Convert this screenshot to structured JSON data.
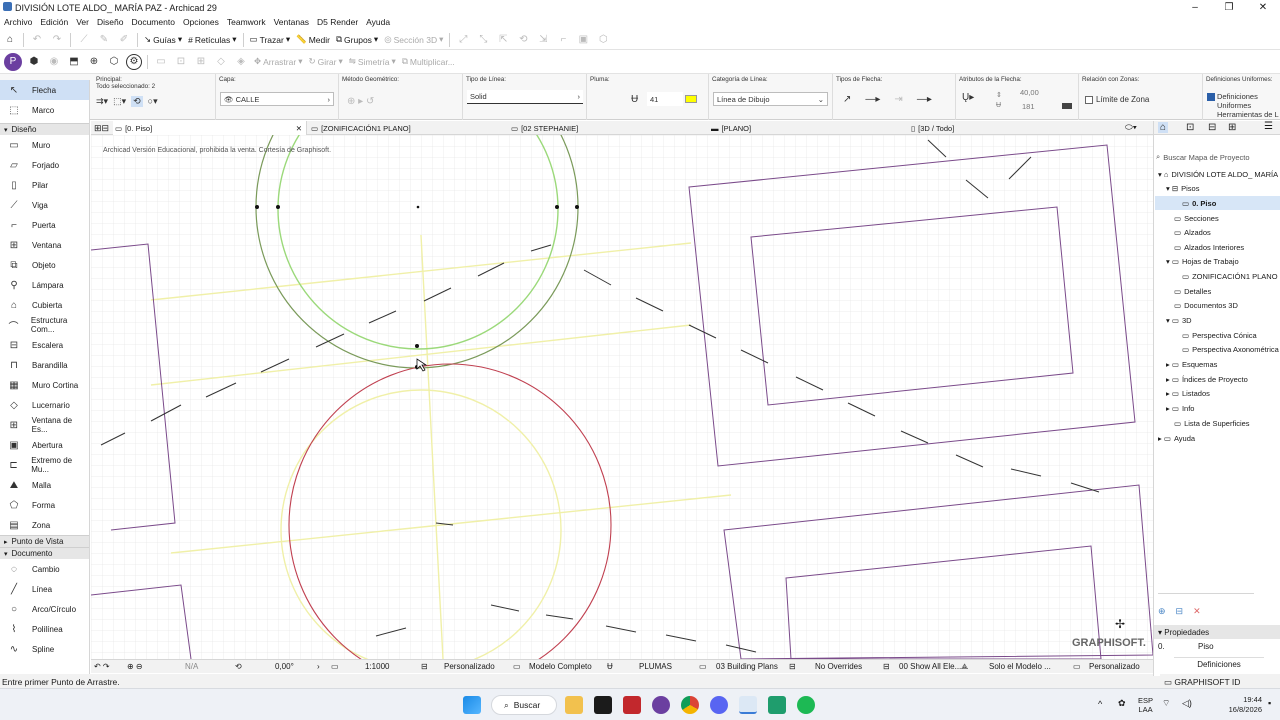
{
  "window": {
    "title": "DIVISIÓN LOTE ALDO_ MARÍA PAZ - Archicad 29",
    "min": "–",
    "max": "❐",
    "close": "✕"
  },
  "menu": [
    "Archivo",
    "Edición",
    "Ver",
    "Diseño",
    "Documento",
    "Opciones",
    "Teamwork",
    "Ventanas",
    "D5 Render",
    "Ayuda"
  ],
  "toolbar1": {
    "guias": "Guías",
    "reticulas": "Retículas",
    "trazar": "Trazar",
    "medir": "Medir",
    "grupos": "Grupos",
    "seccion3d": "Sección 3D"
  },
  "toolbar2": {
    "arrastrar": "Arrastrar",
    "girar": "Girar",
    "simetria": "Simetría",
    "multiplicar": "Multiplicar..."
  },
  "infobox": {
    "principal_label": "Principal:",
    "selected": "Todo seleccionado: 2",
    "capa_label": "Capa:",
    "capa_value": "CALLE",
    "metodo_label": "Método Geométrico:",
    "tipo_linea_label": "Tipo de Línea:",
    "tipo_linea_value": "Solid",
    "pluma_label": "Pluma:",
    "pluma_value": "41",
    "categoria_label": "Categoría de Línea:",
    "categoria_value": "Línea de Dibujo",
    "flecha_label": "Tipos de Flecha:",
    "atributos_label": "Atributos de la Flecha:",
    "atr_size": "40,00",
    "atr_pen": "181",
    "zonas_label": "Relación con Zonas:",
    "limite_label": "Límite de Zona",
    "defs_label": "Definiciones Uniformes:",
    "defs_check": "Definiciones Uniformes Herramientas de L",
    "accent_color": "#ffff00"
  },
  "toolbox": {
    "top": [
      {
        "label": "Flecha",
        "icon": "arrow-icon"
      },
      {
        "label": "Marco",
        "icon": "marquee-icon"
      }
    ],
    "diseno_header": "Diseño",
    "diseno": [
      "Muro",
      "Forjado",
      "Pilar",
      "Viga",
      "Puerta",
      "Ventana",
      "Objeto",
      "Lámpara",
      "Cubierta",
      "Estructura Com...",
      "Escalera",
      "Barandilla",
      "Muro Cortina",
      "Lucernario",
      "Ventana de Es...",
      "Abertura",
      "Extremo de Mu...",
      "Malla",
      "Forma",
      "Zona"
    ],
    "punto_vista": "Punto de Vista",
    "documento_header": "Documento",
    "documento": [
      "Cambio",
      "Línea",
      "Arco/Círculo",
      "Polilínea",
      "Spline"
    ]
  },
  "tabs": [
    {
      "label": "[0. Piso]",
      "close": "✕"
    },
    {
      "label": "[ZONIFICACIÓN1 PLANO]"
    },
    {
      "label": "[02 STEPHANIE]"
    },
    {
      "label": "[PLANO]"
    },
    {
      "label": "[3D / Todo]"
    }
  ],
  "canvas": {
    "watermark": "Archicad Versión Educacional, prohibida la venta. Cortesía de Graphisoft.",
    "logo": "GRAPHISOFT."
  },
  "statusbar": {
    "na": "N/A",
    "angle": "0,00°",
    "scale": "1:1000",
    "personalizado": "Personalizado",
    "modelo": "Modelo Completo",
    "plumas": "PLUMAS",
    "building": "03 Building Plans",
    "overrides": "No Overrides",
    "show": "00 Show All Ele...",
    "solo": "Solo el Modelo ...",
    "personalizado2": "Personalizado"
  },
  "hint": "Entre primer Punto de Arrastre.",
  "navigator": {
    "search": "Buscar Mapa de Proyecto",
    "items": [
      {
        "label": "DIVISIÓN LOTE ALDO_ MARÍA",
        "level": 0
      },
      {
        "label": "Pisos",
        "level": 1
      },
      {
        "label": "0. Piso",
        "level": 2
      },
      {
        "label": "Secciones",
        "level": 1
      },
      {
        "label": "Alzados",
        "level": 1
      },
      {
        "label": "Alzados Interiores",
        "level": 1
      },
      {
        "label": "Hojas de Trabajo",
        "level": 1
      },
      {
        "label": "ZONIFICACIÓN1 PLANO (",
        "level": 2
      },
      {
        "label": "Detalles",
        "level": 1
      },
      {
        "label": "Documentos 3D",
        "level": 1
      },
      {
        "label": "3D",
        "level": 1
      },
      {
        "label": "Perspectiva Cónica",
        "level": 2
      },
      {
        "label": "Perspectiva Axonométrica",
        "level": 2
      },
      {
        "label": "Esquemas",
        "level": 1
      },
      {
        "label": "Índices de Proyecto",
        "level": 1
      },
      {
        "label": "Listados",
        "level": 1
      },
      {
        "label": "Info",
        "level": 1
      },
      {
        "label": "Lista de Superficies",
        "level": 1
      },
      {
        "label": "Ayuda",
        "level": 0
      }
    ],
    "propiedades": "Propiedades",
    "prop_num": "0.",
    "prop_val": "Piso",
    "definiciones": "Definiciones",
    "graphisoft_id": "GRAPHISOFT ID"
  },
  "taskbar": {
    "search": "Buscar",
    "lang1": "ESP",
    "lang2": "LAA",
    "time": "19:44",
    "date": "16/8/2026"
  }
}
